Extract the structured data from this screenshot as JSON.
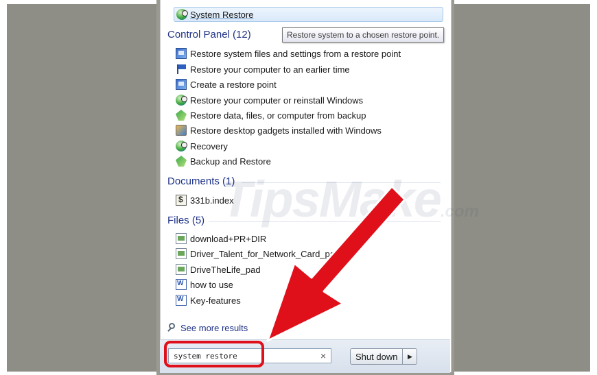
{
  "top_result": {
    "label": "System Restore",
    "icon": "system-restore-icon"
  },
  "tooltip": "Restore system to a chosen restore point.",
  "categories": {
    "control_panel": {
      "title": "Control Panel (12)",
      "items": [
        {
          "label": "Restore system files and settings from a restore point",
          "icon": "control-panel-icon"
        },
        {
          "label": "Restore your computer to an earlier time",
          "icon": "flag-icon"
        },
        {
          "label": "Create a restore point",
          "icon": "control-panel-icon"
        },
        {
          "label": "Restore your computer or reinstall Windows",
          "icon": "recovery-icon"
        },
        {
          "label": "Restore data, files, or computer from backup",
          "icon": "backup-icon"
        },
        {
          "label": "Restore desktop gadgets installed with Windows",
          "icon": "gadget-icon"
        },
        {
          "label": "Recovery",
          "icon": "recovery-icon"
        },
        {
          "label": "Backup and Restore",
          "icon": "backup-icon"
        }
      ]
    },
    "documents": {
      "title": "Documents (1)",
      "items": [
        {
          "label": "331b.index",
          "icon": "document-icon"
        }
      ]
    },
    "files": {
      "title": "Files (5)",
      "items": [
        {
          "label": "download+PR+DIR",
          "icon": "file-icon"
        },
        {
          "label": "Driver_Talent_for_Network_Card_pad",
          "icon": "file-icon"
        },
        {
          "label": "DriveTheLife_pad",
          "icon": "file-icon"
        },
        {
          "label": "how to use",
          "icon": "word-document-icon"
        },
        {
          "label": "Key-features",
          "icon": "word-document-icon"
        }
      ]
    }
  },
  "see_more": "See more results",
  "search": {
    "value": "system restore",
    "clear": "×"
  },
  "shutdown": {
    "label": "Shut down",
    "arrow": "▶"
  },
  "watermark": {
    "text": "TipsMake",
    "suffix": ".com"
  },
  "colors": {
    "highlight": "#e0101b",
    "category": "#1e3287",
    "menu_bottom": "#dfe6f0",
    "backdrop": "#8e8e86"
  }
}
